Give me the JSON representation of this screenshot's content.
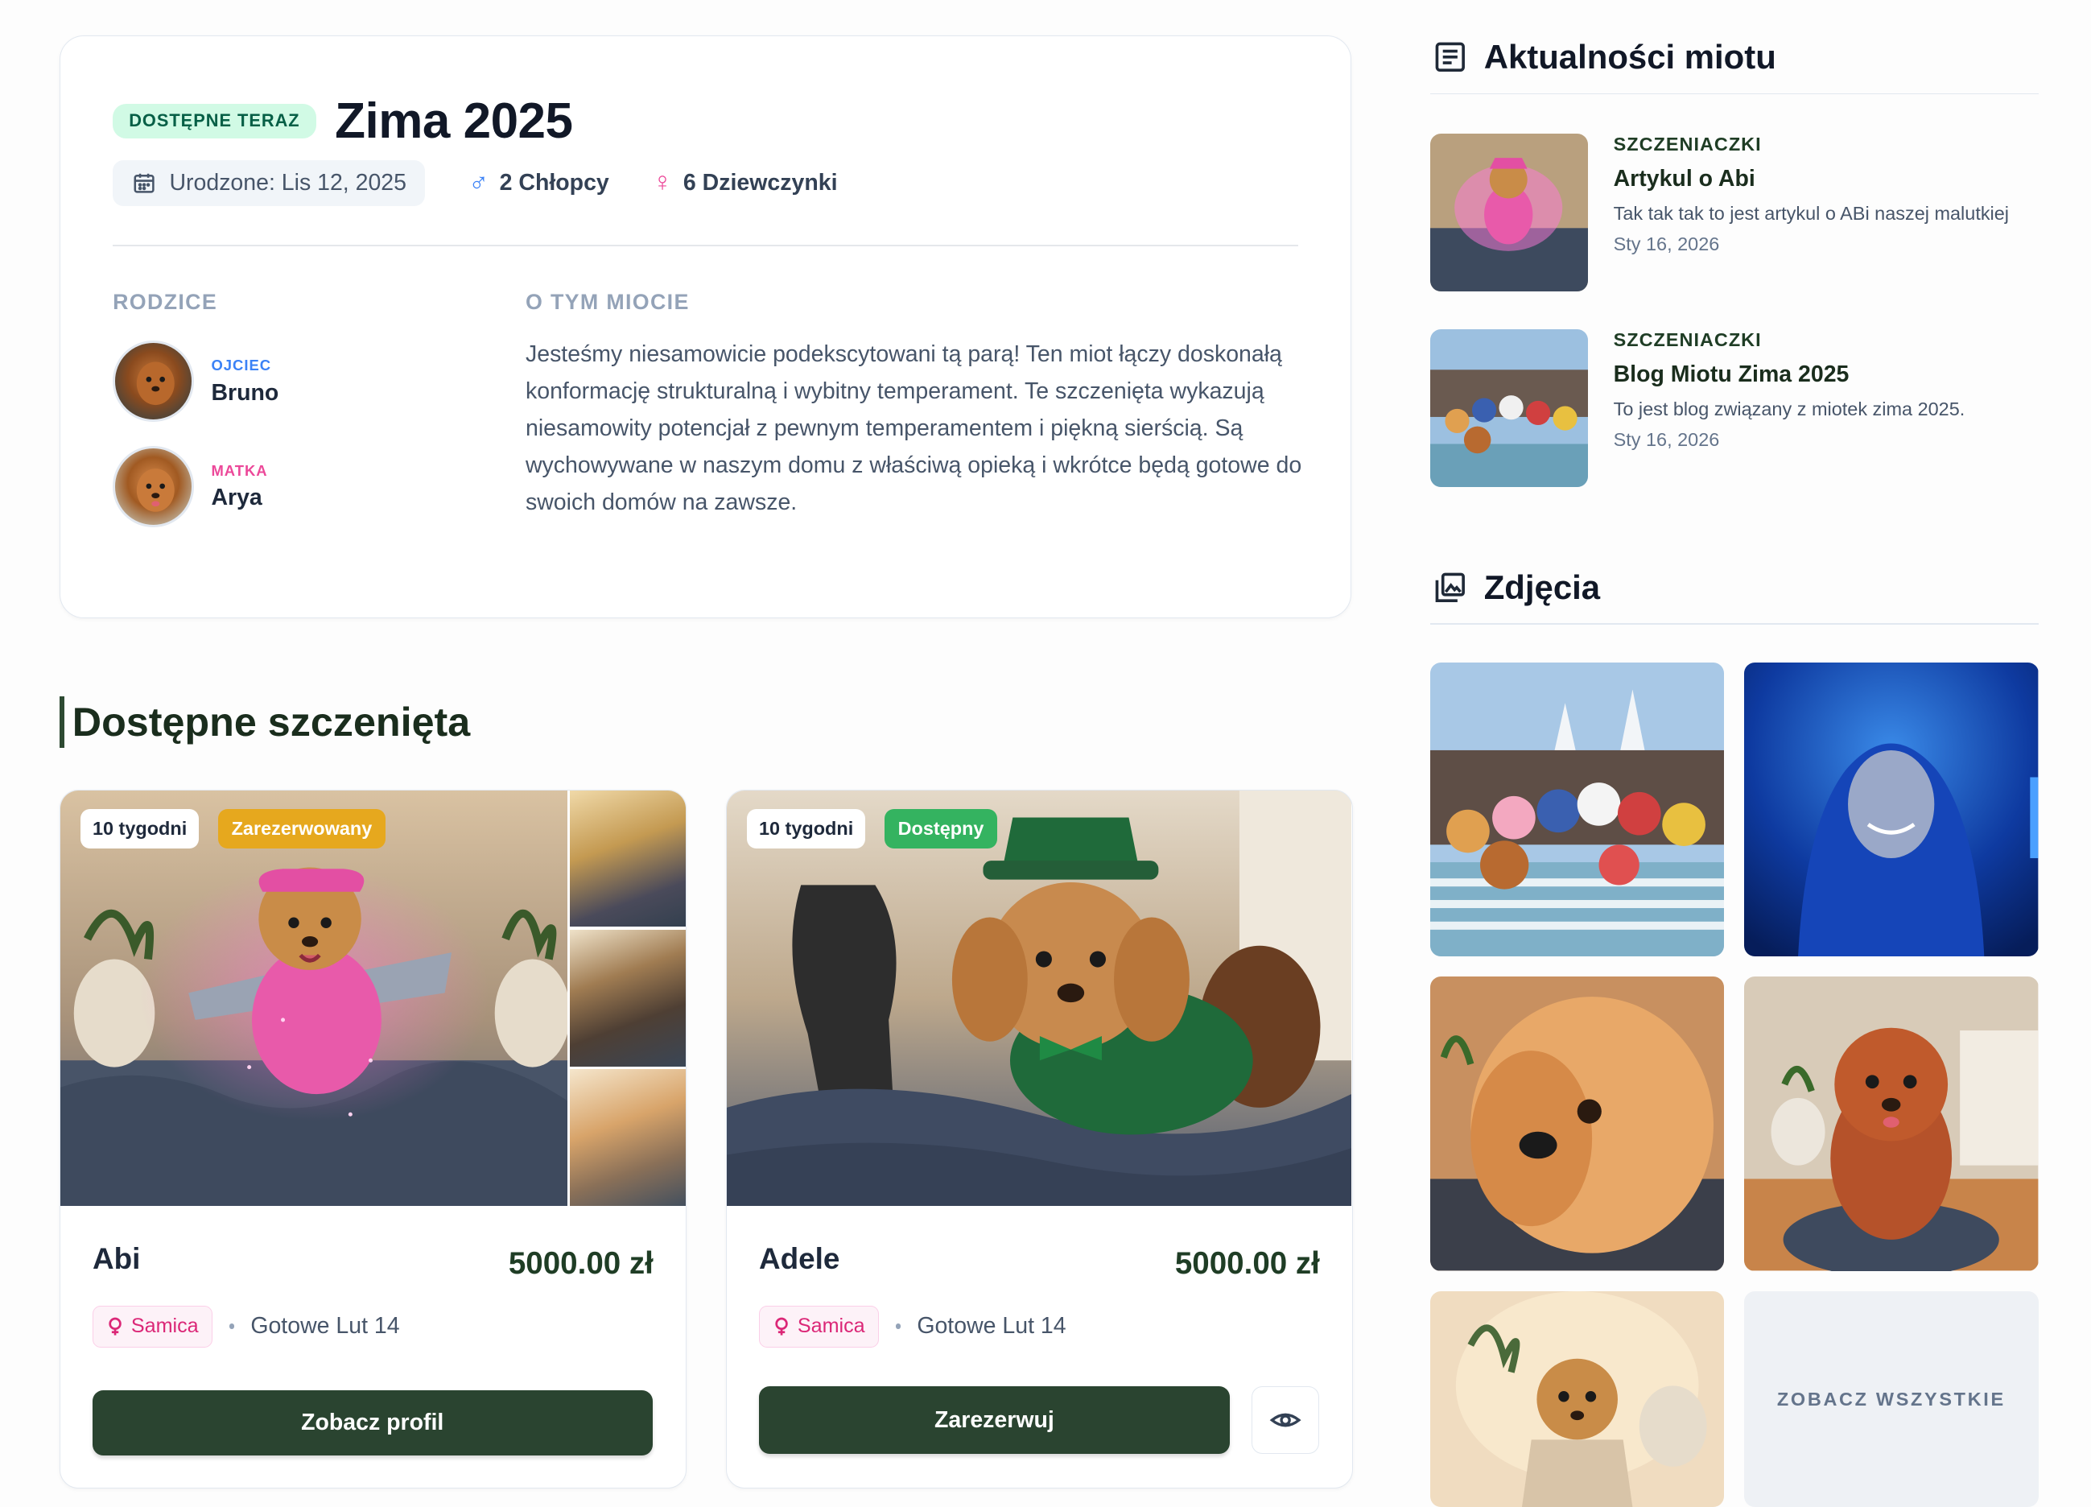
{
  "litter": {
    "status_badge": "DOSTĘPNE TERAZ",
    "title": "Zima 2025",
    "birth_label": "Urodzone: Lis 12, 2025",
    "boys": "2 Chłopcy",
    "girls": "6 Dziewczynki",
    "parents_label": "RODZICE",
    "sire_role": "OJCIEC",
    "sire_name": "Bruno",
    "dam_role": "MATKA",
    "dam_name": "Arya",
    "about_label": "O TYM MIOCIE",
    "about_text": "Jesteśmy niesamowicie podekscytowani tą parą! Ten miot łączy doskonałą konformację strukturalną i wybitny temperament. Te szczenięta wykazują niesamowity potencjał z pewnym temperamentem i piękną sierścią. Są wychowywane w naszym domu z właściwą opieką i wkrótce będą gotowe do swoich domów na zawsze."
  },
  "puppies_section": {
    "heading": "Dostępne szczenięta",
    "items": [
      {
        "age": "10 tygodni",
        "status": "Zarezerwowany",
        "name": "Abi",
        "price": "5000.00 zł",
        "sex": "Samica",
        "ready": "Gotowe Lut 14",
        "button": "Zobacz profil"
      },
      {
        "age": "10 tygodni",
        "status": "Dostępny",
        "name": "Adele",
        "price": "5000.00 zł",
        "sex": "Samica",
        "ready": "Gotowe Lut 14",
        "button": "Zarezerwuj"
      }
    ]
  },
  "news": {
    "heading": "Aktualności miotu",
    "items": [
      {
        "category": "SZCZENIACZKI",
        "title": "Artykul o Abi",
        "excerpt": "Tak tak tak to jest artykul o ABi naszej malutkiej",
        "date": "Sty 16, 2026"
      },
      {
        "category": "SZCZENIACZKI",
        "title": "Blog Miotu Zima 2025",
        "excerpt": "To jest blog związany z miotek zima 2025.",
        "date": "Sty 16, 2026"
      }
    ]
  },
  "photos": {
    "heading": "Zdjęcia",
    "see_all": "ZOBACZ WSZYSTKIE"
  },
  "colors": {
    "brand_dark_green": "#2a4430",
    "available_badge_bg": "#d1fae5",
    "reserved": "#e6a81e",
    "available": "#34b360",
    "male": "#3b82f6",
    "female": "#ec4899"
  }
}
